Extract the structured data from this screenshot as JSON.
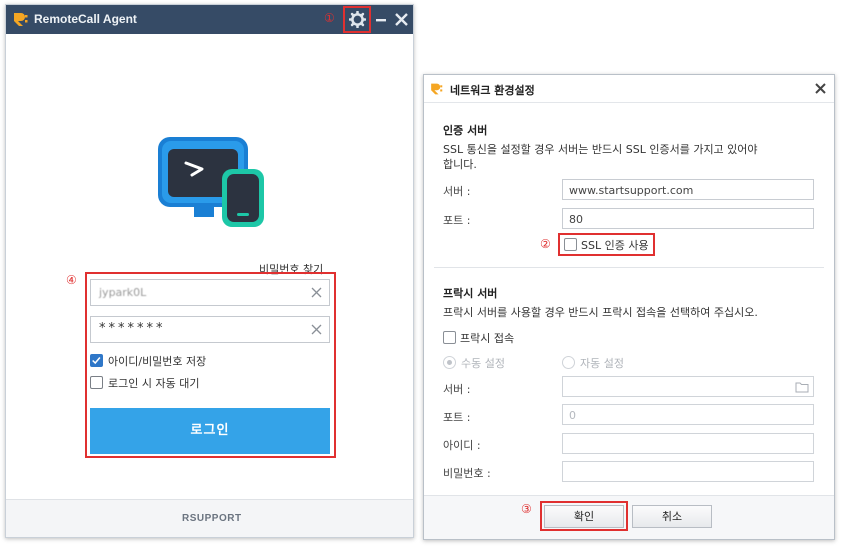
{
  "colors": {
    "titlebar": "#364b66",
    "accent": "#34a3e8",
    "annotation": "#e03030",
    "checkbox_checked": "#2f77c8"
  },
  "left_window": {
    "title": "RemoteCall Agent",
    "icons": {
      "logo": "rsupport-logo-icon",
      "settings": "gear-icon",
      "minimize": "minimize-icon",
      "close": "close-icon"
    },
    "annotation_settings": "①",
    "annotation_login": "④",
    "find_password_link": "비밀번호 찾기",
    "id_field_value": "jypark0L",
    "password_field_value": "*******",
    "save_credentials_label": "아이디/비밀번호 저장",
    "save_credentials_checked": true,
    "auto_wait_label": "로그인 시 자동 대기",
    "auto_wait_checked": false,
    "login_button": "로그인",
    "footer_brand": "RSUPPORT"
  },
  "network_dialog": {
    "title": "네트워크 환경설정",
    "icons": {
      "logo": "rsupport-logo-icon",
      "close": "close-icon",
      "folder": "folder-icon"
    },
    "auth_section": {
      "heading": "인증 서버",
      "description_line1": "SSL 통신을 설정할 경우 서버는 반드시 SSL 인증서를 가지고 있어야",
      "description_line2": "합니다.",
      "server_label": "서버 :",
      "server_value": "www.startsupport.com",
      "port_label": "포트 :",
      "port_value": "80",
      "ssl_label": "SSL 인증 사용",
      "ssl_checked": false,
      "annotation": "②"
    },
    "proxy_section": {
      "heading": "프락시 서버",
      "description": "프락시 서버를 사용할 경우 반드시 프락시 접속을 선택하여 주십시오.",
      "proxy_connect_label": "프락시 접속",
      "proxy_connect_checked": false,
      "manual_label": "수동 설정",
      "auto_label": "자동 설정",
      "server_label": "서버 :",
      "server_value": "",
      "port_label": "포트 :",
      "port_value": "0",
      "id_label": "아이디 :",
      "id_value": "",
      "password_label": "비밀번호 :",
      "password_value": ""
    },
    "ok_button": "확인",
    "cancel_button": "취소",
    "annotation_ok": "③"
  }
}
